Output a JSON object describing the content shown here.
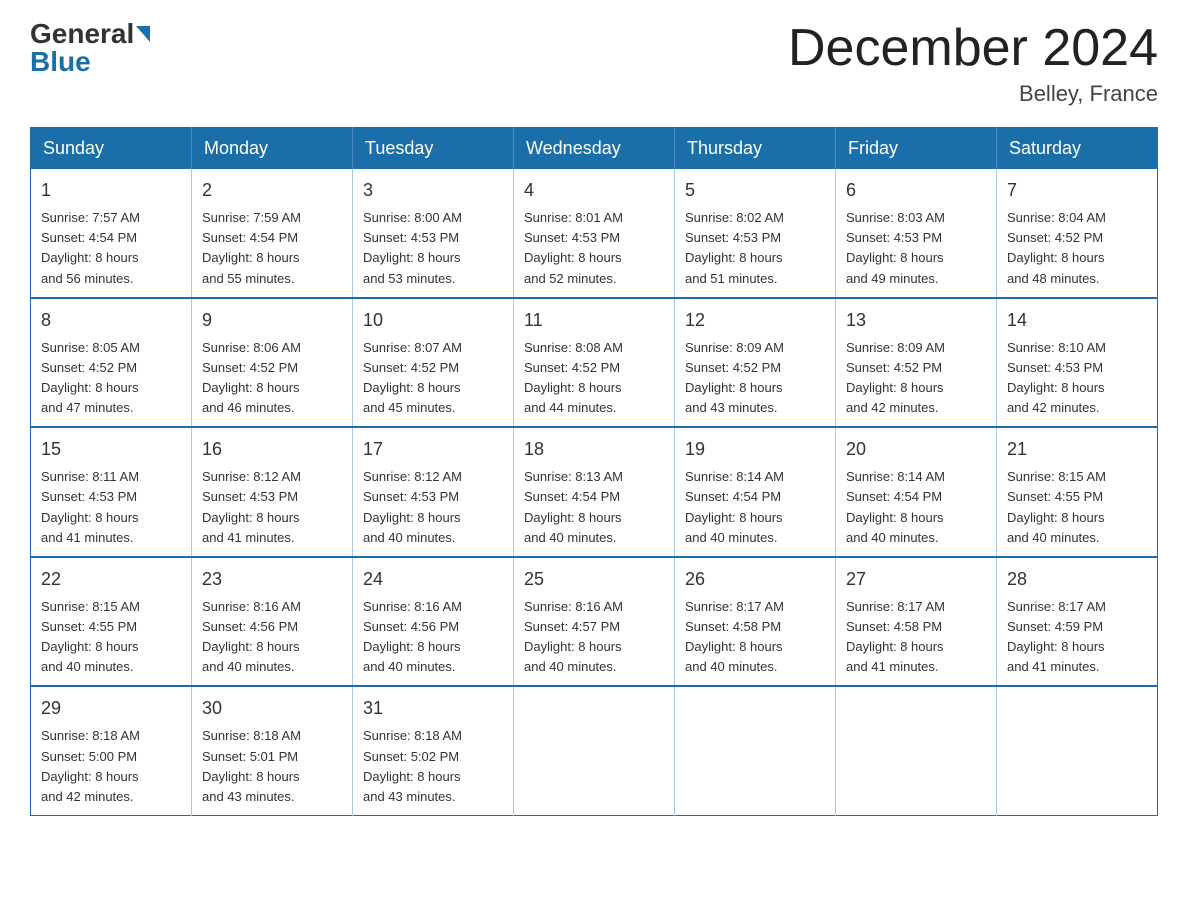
{
  "logo": {
    "general": "General",
    "blue": "Blue"
  },
  "title": "December 2024",
  "location": "Belley, France",
  "days_header": [
    "Sunday",
    "Monday",
    "Tuesday",
    "Wednesday",
    "Thursday",
    "Friday",
    "Saturday"
  ],
  "weeks": [
    [
      {
        "day": "1",
        "sunrise": "7:57 AM",
        "sunset": "4:54 PM",
        "daylight": "8 hours and 56 minutes."
      },
      {
        "day": "2",
        "sunrise": "7:59 AM",
        "sunset": "4:54 PM",
        "daylight": "8 hours and 55 minutes."
      },
      {
        "day": "3",
        "sunrise": "8:00 AM",
        "sunset": "4:53 PM",
        "daylight": "8 hours and 53 minutes."
      },
      {
        "day": "4",
        "sunrise": "8:01 AM",
        "sunset": "4:53 PM",
        "daylight": "8 hours and 52 minutes."
      },
      {
        "day": "5",
        "sunrise": "8:02 AM",
        "sunset": "4:53 PM",
        "daylight": "8 hours and 51 minutes."
      },
      {
        "day": "6",
        "sunrise": "8:03 AM",
        "sunset": "4:53 PM",
        "daylight": "8 hours and 49 minutes."
      },
      {
        "day": "7",
        "sunrise": "8:04 AM",
        "sunset": "4:52 PM",
        "daylight": "8 hours and 48 minutes."
      }
    ],
    [
      {
        "day": "8",
        "sunrise": "8:05 AM",
        "sunset": "4:52 PM",
        "daylight": "8 hours and 47 minutes."
      },
      {
        "day": "9",
        "sunrise": "8:06 AM",
        "sunset": "4:52 PM",
        "daylight": "8 hours and 46 minutes."
      },
      {
        "day": "10",
        "sunrise": "8:07 AM",
        "sunset": "4:52 PM",
        "daylight": "8 hours and 45 minutes."
      },
      {
        "day": "11",
        "sunrise": "8:08 AM",
        "sunset": "4:52 PM",
        "daylight": "8 hours and 44 minutes."
      },
      {
        "day": "12",
        "sunrise": "8:09 AM",
        "sunset": "4:52 PM",
        "daylight": "8 hours and 43 minutes."
      },
      {
        "day": "13",
        "sunrise": "8:09 AM",
        "sunset": "4:52 PM",
        "daylight": "8 hours and 42 minutes."
      },
      {
        "day": "14",
        "sunrise": "8:10 AM",
        "sunset": "4:53 PM",
        "daylight": "8 hours and 42 minutes."
      }
    ],
    [
      {
        "day": "15",
        "sunrise": "8:11 AM",
        "sunset": "4:53 PM",
        "daylight": "8 hours and 41 minutes."
      },
      {
        "day": "16",
        "sunrise": "8:12 AM",
        "sunset": "4:53 PM",
        "daylight": "8 hours and 41 minutes."
      },
      {
        "day": "17",
        "sunrise": "8:12 AM",
        "sunset": "4:53 PM",
        "daylight": "8 hours and 40 minutes."
      },
      {
        "day": "18",
        "sunrise": "8:13 AM",
        "sunset": "4:54 PM",
        "daylight": "8 hours and 40 minutes."
      },
      {
        "day": "19",
        "sunrise": "8:14 AM",
        "sunset": "4:54 PM",
        "daylight": "8 hours and 40 minutes."
      },
      {
        "day": "20",
        "sunrise": "8:14 AM",
        "sunset": "4:54 PM",
        "daylight": "8 hours and 40 minutes."
      },
      {
        "day": "21",
        "sunrise": "8:15 AM",
        "sunset": "4:55 PM",
        "daylight": "8 hours and 40 minutes."
      }
    ],
    [
      {
        "day": "22",
        "sunrise": "8:15 AM",
        "sunset": "4:55 PM",
        "daylight": "8 hours and 40 minutes."
      },
      {
        "day": "23",
        "sunrise": "8:16 AM",
        "sunset": "4:56 PM",
        "daylight": "8 hours and 40 minutes."
      },
      {
        "day": "24",
        "sunrise": "8:16 AM",
        "sunset": "4:56 PM",
        "daylight": "8 hours and 40 minutes."
      },
      {
        "day": "25",
        "sunrise": "8:16 AM",
        "sunset": "4:57 PM",
        "daylight": "8 hours and 40 minutes."
      },
      {
        "day": "26",
        "sunrise": "8:17 AM",
        "sunset": "4:58 PM",
        "daylight": "8 hours and 40 minutes."
      },
      {
        "day": "27",
        "sunrise": "8:17 AM",
        "sunset": "4:58 PM",
        "daylight": "8 hours and 41 minutes."
      },
      {
        "day": "28",
        "sunrise": "8:17 AM",
        "sunset": "4:59 PM",
        "daylight": "8 hours and 41 minutes."
      }
    ],
    [
      {
        "day": "29",
        "sunrise": "8:18 AM",
        "sunset": "5:00 PM",
        "daylight": "8 hours and 42 minutes."
      },
      {
        "day": "30",
        "sunrise": "8:18 AM",
        "sunset": "5:01 PM",
        "daylight": "8 hours and 43 minutes."
      },
      {
        "day": "31",
        "sunrise": "8:18 AM",
        "sunset": "5:02 PM",
        "daylight": "8 hours and 43 minutes."
      },
      null,
      null,
      null,
      null
    ]
  ],
  "labels": {
    "sunrise": "Sunrise:",
    "sunset": "Sunset:",
    "daylight": "Daylight:"
  }
}
